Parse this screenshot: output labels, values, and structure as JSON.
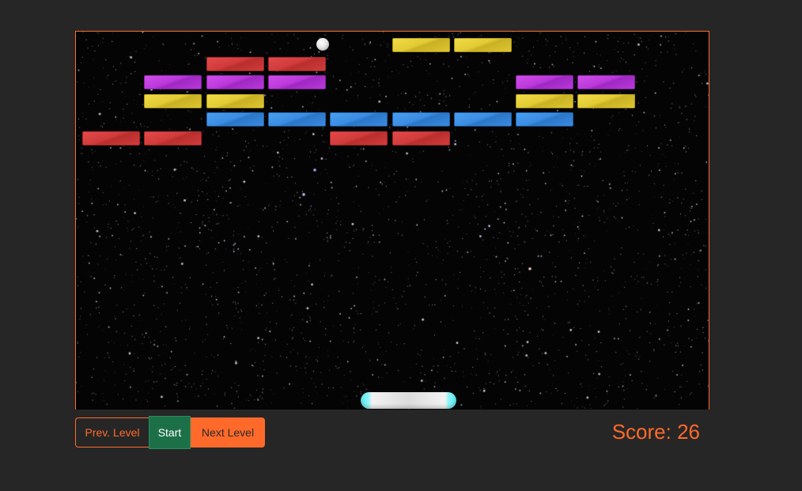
{
  "game": {
    "bricks": [
      {
        "row": 0,
        "col": 5,
        "color": "yellow"
      },
      {
        "row": 0,
        "col": 6,
        "color": "yellow"
      },
      {
        "row": 1,
        "col": 2,
        "color": "red"
      },
      {
        "row": 1,
        "col": 3,
        "color": "red"
      },
      {
        "row": 2,
        "col": 1,
        "color": "magenta"
      },
      {
        "row": 2,
        "col": 2,
        "color": "magenta"
      },
      {
        "row": 2,
        "col": 3,
        "color": "magenta"
      },
      {
        "row": 2,
        "col": 7,
        "color": "magenta"
      },
      {
        "row": 2,
        "col": 8,
        "color": "magenta"
      },
      {
        "row": 3,
        "col": 1,
        "color": "yellow"
      },
      {
        "row": 3,
        "col": 2,
        "color": "yellow"
      },
      {
        "row": 3,
        "col": 7,
        "color": "yellow"
      },
      {
        "row": 3,
        "col": 8,
        "color": "yellow"
      },
      {
        "row": 4,
        "col": 2,
        "color": "blue"
      },
      {
        "row": 4,
        "col": 3,
        "color": "blue"
      },
      {
        "row": 4,
        "col": 4,
        "color": "blue"
      },
      {
        "row": 4,
        "col": 5,
        "color": "blue"
      },
      {
        "row": 4,
        "col": 6,
        "color": "blue"
      },
      {
        "row": 4,
        "col": 7,
        "color": "blue"
      },
      {
        "row": 5,
        "col": 0,
        "color": "red"
      },
      {
        "row": 5,
        "col": 1,
        "color": "red"
      },
      {
        "row": 5,
        "col": 4,
        "color": "red"
      },
      {
        "row": 5,
        "col": 5,
        "color": "red"
      }
    ],
    "ball_icon": "ball-icon",
    "paddle_icon": "paddle"
  },
  "controls": {
    "prev_label": "Prev. Level",
    "start_label": "Start",
    "next_label": "Next Level"
  },
  "score": {
    "text": "Score: 26"
  },
  "colors": {
    "accent": "#ff6a2b",
    "start_button": "#1c7048",
    "background": "#262626",
    "playfield": "#040404"
  }
}
